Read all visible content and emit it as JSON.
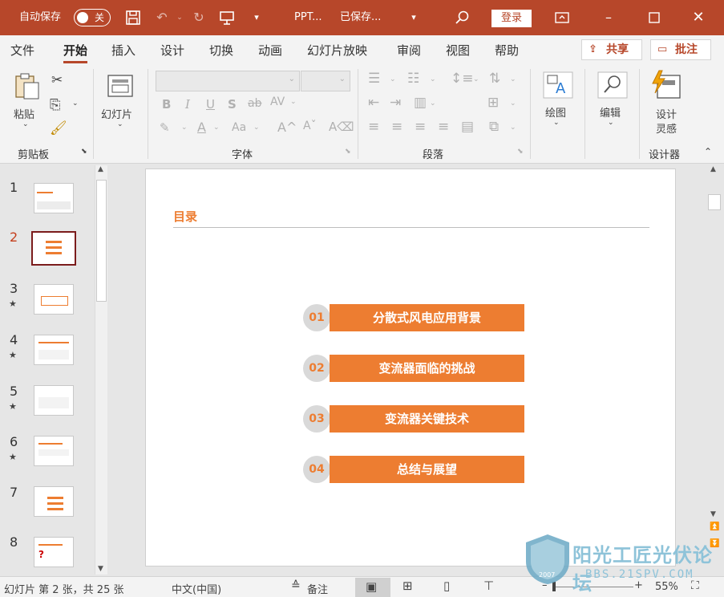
{
  "titlebar": {
    "autosave_label": "自动保存",
    "autosave_state": "关",
    "title": "PPT...",
    "saved_status": "已保存...",
    "login_label": "登录"
  },
  "tabs": [
    "文件",
    "开始",
    "插入",
    "设计",
    "切换",
    "动画",
    "幻灯片放映",
    "审阅",
    "视图",
    "帮助"
  ],
  "active_tab": "开始",
  "share_label": "共享",
  "comment_label": "批注",
  "ribbon": {
    "paste_label": "粘贴",
    "clipboard_group": "剪贴板",
    "slide_label": "幻灯片",
    "font_group": "字体",
    "paragraph_group": "段落",
    "draw_label": "绘图",
    "edit_label": "编辑",
    "designer_label_1": "设计",
    "designer_label_2": "灵感",
    "designer_group": "设计器"
  },
  "thumbnails": [
    {
      "num": "1",
      "star": false
    },
    {
      "num": "2",
      "star": false,
      "selected": true
    },
    {
      "num": "3",
      "star": true
    },
    {
      "num": "4",
      "star": true
    },
    {
      "num": "5",
      "star": true
    },
    {
      "num": "6",
      "star": true
    },
    {
      "num": "7",
      "star": false
    },
    {
      "num": "8",
      "star": false
    }
  ],
  "slide": {
    "title": "目录",
    "items": [
      {
        "num": "01",
        "text": "分散式风电应用背景"
      },
      {
        "num": "02",
        "text": "变流器面临的挑战"
      },
      {
        "num": "03",
        "text": "变流器关键技术"
      },
      {
        "num": "04",
        "text": "总结与展望"
      }
    ]
  },
  "status": {
    "slide_info": "幻灯片 第 2 张，共 25 张",
    "language": "中文(中国)",
    "notes_label": "备注",
    "zoom": "55%"
  },
  "watermark": {
    "text": "阳光工匠光伏论坛",
    "url": "BBS.21SPV.COM",
    "year": "2007"
  },
  "colors": {
    "accent": "#b7472a",
    "slide_orange": "#ed7d31",
    "selected_thumb": "#7b1c1c"
  }
}
